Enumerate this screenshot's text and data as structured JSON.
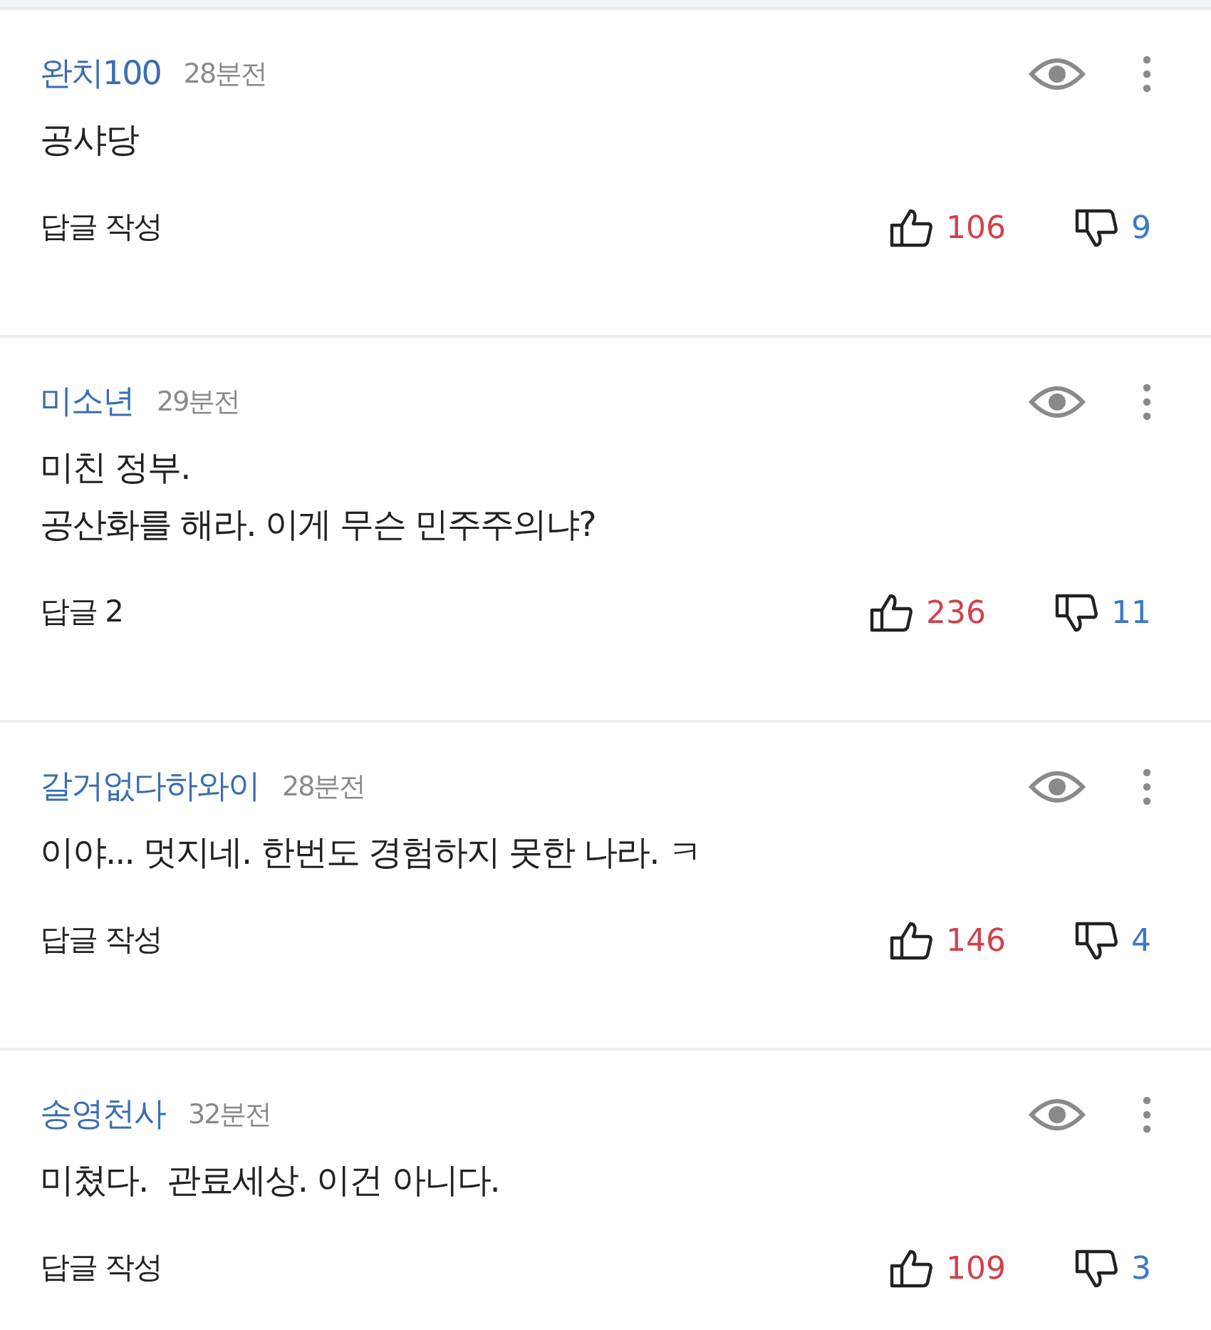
{
  "comments": [
    {
      "author": "완치100",
      "time": "28분전",
      "lines": [
        "공샤당"
      ],
      "reply": "답글 작성",
      "likes": "106",
      "dislikes": "9"
    },
    {
      "author": "미소년",
      "time": "29분전",
      "lines": [
        "미친 정부.",
        "공산화를 해라. 이게 무슨 민주주의냐?"
      ],
      "reply": "답글 2",
      "likes": "236",
      "dislikes": "11"
    },
    {
      "author": "갈거없다하와이",
      "time": "28분전",
      "lines": [
        "이야... 멋지네. 한번도 경험하지 못한 나라. ㅋ"
      ],
      "reply": "답글 작성",
      "likes": "146",
      "dislikes": "4"
    },
    {
      "author": "송영천사",
      "time": "32분전",
      "lines": [
        "미쳤다.  관료세상. 이건 아니다."
      ],
      "reply": "답글 작성",
      "likes": "109",
      "dislikes": "3"
    }
  ]
}
